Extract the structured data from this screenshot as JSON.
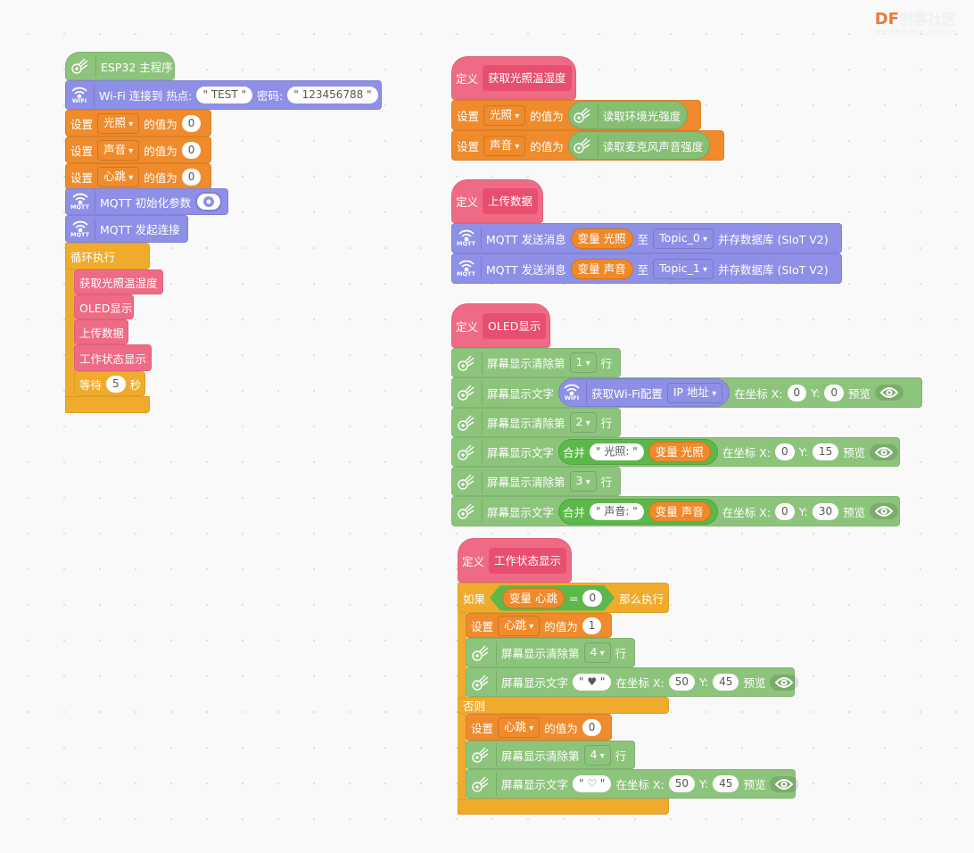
{
  "watermark": {
    "brand_df": "DF",
    "brand_cn": "创客社区",
    "url": "mc.DFRobot.com.cn"
  },
  "colors": {
    "esp": "#8dc47c",
    "wifi": "#8e8fe6",
    "set": "#ef8b2c",
    "control": "#f0ab2d",
    "proc": "#ef6b85",
    "reporter_green": "#86be74"
  },
  "scripts": [
    {
      "rows": [
        {
          "kind": "hat",
          "cat": "esp",
          "parts": [
            {
              "k": "icon",
              "icon": "esp32-hand-icon"
            },
            {
              "k": "t",
              "v": "ESP32 主程序"
            }
          ]
        },
        {
          "kind": "block",
          "cat": "wifi",
          "parts": [
            {
              "k": "icon",
              "icon": "wifi-icon",
              "label": "WIFI"
            },
            {
              "k": "t",
              "v": "Wi-Fi 连接到 热点:"
            },
            {
              "k": "s",
              "v": "\" TEST \""
            },
            {
              "k": "t",
              "v": "密码:"
            },
            {
              "k": "s",
              "v": "\" 123456788 \""
            }
          ]
        },
        {
          "kind": "block",
          "cat": "set",
          "parts": [
            {
              "k": "t",
              "v": "设置"
            },
            {
              "k": "d",
              "v": "光照"
            },
            {
              "k": "t",
              "v": "的值为"
            },
            {
              "k": "n",
              "v": "0"
            }
          ]
        },
        {
          "kind": "block",
          "cat": "set",
          "parts": [
            {
              "k": "t",
              "v": "设置"
            },
            {
              "k": "d",
              "v": "声音"
            },
            {
              "k": "t",
              "v": "的值为"
            },
            {
              "k": "n",
              "v": "0"
            }
          ]
        },
        {
          "kind": "block",
          "cat": "set",
          "parts": [
            {
              "k": "t",
              "v": "设置"
            },
            {
              "k": "d",
              "v": "心跳"
            },
            {
              "k": "t",
              "v": "的值为"
            },
            {
              "k": "n",
              "v": "0"
            }
          ]
        },
        {
          "kind": "block",
          "cat": "wifi",
          "parts": [
            {
              "k": "icon",
              "icon": "mqtt-icon",
              "label": "MQTT"
            },
            {
              "k": "t",
              "v": "MQTT 初始化参数"
            },
            {
              "k": "gear"
            }
          ]
        },
        {
          "kind": "block",
          "cat": "wifi",
          "parts": [
            {
              "k": "icon",
              "icon": "mqtt-icon",
              "label": "MQTT"
            },
            {
              "k": "t",
              "v": "MQTT 发起连接"
            }
          ]
        },
        {
          "kind": "arm",
          "cat": "control",
          "parts": []
        },
        {
          "kind": "block",
          "cat": "control",
          "parts": [
            {
              "k": "t",
              "v": "循环执行"
            }
          ]
        },
        {
          "kind": "block",
          "cat": "proc",
          "parts": [
            {
              "k": "t",
              "v": "获取光照温湿度"
            }
          ]
        },
        {
          "kind": "block",
          "cat": "proc",
          "parts": [
            {
              "k": "t",
              "v": "OLED显示"
            }
          ]
        },
        {
          "kind": "block",
          "cat": "proc",
          "parts": [
            {
              "k": "t",
              "v": "上传数据"
            }
          ]
        },
        {
          "kind": "block",
          "cat": "proc",
          "parts": [
            {
              "k": "t",
              "v": "工作状态显示"
            }
          ]
        },
        {
          "kind": "block",
          "cat": "control",
          "parts": [
            {
              "k": "t",
              "v": "等待"
            },
            {
              "k": "n",
              "v": "5"
            },
            {
              "k": "t",
              "v": "秒"
            }
          ]
        },
        {
          "kind": "cap",
          "cat": "control",
          "parts": []
        }
      ]
    },
    {
      "rows": [
        {
          "kind": "defhat",
          "cat": "proc",
          "parts": [
            {
              "k": "t",
              "v": "定义"
            },
            {
              "k": "def",
              "v": "获取光照温湿度"
            }
          ]
        },
        {
          "kind": "block",
          "cat": "set",
          "parts": [
            {
              "k": "t",
              "v": "设置"
            },
            {
              "k": "d",
              "v": "光照"
            },
            {
              "k": "t",
              "v": "的值为"
            },
            {
              "k": "rep",
              "cat": "reporter_green",
              "parts": [
                {
                  "k": "icon",
                  "icon": "esp32-hand-icon"
                },
                {
                  "k": "t",
                  "v": "读取环境光强度"
                }
              ]
            }
          ]
        },
        {
          "kind": "block",
          "cat": "set",
          "parts": [
            {
              "k": "t",
              "v": "设置"
            },
            {
              "k": "d",
              "v": "声音"
            },
            {
              "k": "t",
              "v": "的值为"
            },
            {
              "k": "rep",
              "cat": "reporter_green",
              "parts": [
                {
                  "k": "icon",
                  "icon": "esp32-hand-icon"
                },
                {
                  "k": "t",
                  "v": "读取麦克风声音强度"
                }
              ]
            }
          ]
        }
      ]
    },
    {
      "rows": [
        {
          "kind": "defhat",
          "cat": "proc",
          "parts": [
            {
              "k": "t",
              "v": "定义"
            },
            {
              "k": "def",
              "v": "上传数据"
            }
          ]
        },
        {
          "kind": "block",
          "cat": "wifi",
          "parts": [
            {
              "k": "icon",
              "icon": "mqtt-icon",
              "label": "MQTT"
            },
            {
              "k": "t",
              "v": "MQTT 发送消息"
            },
            {
              "k": "v",
              "v": "变量 光照"
            },
            {
              "k": "t",
              "v": "至"
            },
            {
              "k": "d",
              "v": "Topic_0"
            },
            {
              "k": "t",
              "v": "并存数据库 (SIoT V2)"
            }
          ]
        },
        {
          "kind": "block",
          "cat": "wifi",
          "parts": [
            {
              "k": "icon",
              "icon": "mqtt-icon",
              "label": "MQTT"
            },
            {
              "k": "t",
              "v": "MQTT 发送消息"
            },
            {
              "k": "v",
              "v": "变量 声音"
            },
            {
              "k": "t",
              "v": "至"
            },
            {
              "k": "d",
              "v": "Topic_1"
            },
            {
              "k": "t",
              "v": "并存数据库 (SIoT V2)"
            }
          ]
        }
      ]
    },
    {
      "rows": [
        {
          "kind": "defhat",
          "cat": "proc",
          "parts": [
            {
              "k": "t",
              "v": "定义"
            },
            {
              "k": "def",
              "v": "OLED显示"
            }
          ]
        },
        {
          "kind": "block",
          "cat": "esp",
          "parts": [
            {
              "k": "icon",
              "icon": "esp32-hand-icon"
            },
            {
              "k": "t",
              "v": "屏幕显示清除第"
            },
            {
              "k": "d",
              "v": "1"
            },
            {
              "k": "t",
              "v": "行"
            }
          ]
        },
        {
          "kind": "block",
          "cat": "esp",
          "parts": [
            {
              "k": "icon",
              "icon": "esp32-hand-icon"
            },
            {
              "k": "t",
              "v": "屏幕显示文字"
            },
            {
              "k": "rep",
              "cat": "wifi",
              "parts": [
                {
                  "k": "icon",
                  "icon": "wifi-icon",
                  "label": "WIFI"
                },
                {
                  "k": "t",
                  "v": "获取Wi-Fi配置"
                },
                {
                  "k": "d",
                  "v": "IP 地址"
                }
              ]
            },
            {
              "k": "t",
              "v": "在坐标 X:"
            },
            {
              "k": "n",
              "v": "0"
            },
            {
              "k": "t",
              "v": "Y:"
            },
            {
              "k": "n",
              "v": "0"
            },
            {
              "k": "t",
              "v": "预览"
            },
            {
              "k": "eye"
            }
          ]
        },
        {
          "kind": "block",
          "cat": "esp",
          "parts": [
            {
              "k": "icon",
              "icon": "esp32-hand-icon"
            },
            {
              "k": "t",
              "v": "屏幕显示清除第"
            },
            {
              "k": "d",
              "v": "2"
            },
            {
              "k": "t",
              "v": "行"
            }
          ]
        },
        {
          "kind": "block",
          "cat": "esp",
          "parts": [
            {
              "k": "icon",
              "icon": "esp32-hand-icon"
            },
            {
              "k": "t",
              "v": "屏幕显示文字"
            },
            {
              "k": "rep",
              "cat": "join",
              "parts": [
                {
                  "k": "t",
                  "v": "合并"
                },
                {
                  "k": "s",
                  "v": "\" 光照: \""
                },
                {
                  "k": "v",
                  "v": "变量 光照"
                }
              ]
            },
            {
              "k": "t",
              "v": "在坐标 X:"
            },
            {
              "k": "n",
              "v": "0"
            },
            {
              "k": "t",
              "v": "Y:"
            },
            {
              "k": "n",
              "v": "15"
            },
            {
              "k": "t",
              "v": "预览"
            },
            {
              "k": "eye"
            }
          ]
        },
        {
          "kind": "block",
          "cat": "esp",
          "parts": [
            {
              "k": "icon",
              "icon": "esp32-hand-icon"
            },
            {
              "k": "t",
              "v": "屏幕显示清除第"
            },
            {
              "k": "d",
              "v": "3"
            },
            {
              "k": "t",
              "v": "行"
            }
          ]
        },
        {
          "kind": "block",
          "cat": "esp",
          "parts": [
            {
              "k": "icon",
              "icon": "esp32-hand-icon"
            },
            {
              "k": "t",
              "v": "屏幕显示文字"
            },
            {
              "k": "rep",
              "cat": "join",
              "parts": [
                {
                  "k": "t",
                  "v": "合并"
                },
                {
                  "k": "s",
                  "v": "\" 声音: \""
                },
                {
                  "k": "v",
                  "v": "变量 声音"
                }
              ]
            },
            {
              "k": "t",
              "v": "在坐标 X:"
            },
            {
              "k": "n",
              "v": "0"
            },
            {
              "k": "t",
              "v": "Y:"
            },
            {
              "k": "n",
              "v": "30"
            },
            {
              "k": "t",
              "v": "预览"
            },
            {
              "k": "eye"
            }
          ]
        }
      ]
    },
    {
      "rows": [
        {
          "kind": "defhat",
          "cat": "proc",
          "parts": [
            {
              "k": "t",
              "v": "定义"
            },
            {
              "k": "def",
              "v": "工作状态显示"
            }
          ]
        },
        {
          "kind": "arm",
          "cat": "control",
          "parts": []
        },
        {
          "kind": "block",
          "cat": "control",
          "parts": [
            {
              "k": "t",
              "v": "如果"
            },
            {
              "k": "bool",
              "parts": [
                {
                  "k": "v",
                  "v": "变量 心跳"
                },
                {
                  "k": "t",
                  "v": "="
                },
                {
                  "k": "n",
                  "v": "0"
                }
              ]
            },
            {
              "k": "t",
              "v": "那么执行"
            }
          ]
        },
        {
          "kind": "block",
          "cat": "set",
          "parts": [
            {
              "k": "t",
              "v": "设置"
            },
            {
              "k": "d",
              "v": "心跳"
            },
            {
              "k": "t",
              "v": "的值为"
            },
            {
              "k": "n",
              "v": "1"
            }
          ]
        },
        {
          "kind": "block",
          "cat": "esp",
          "parts": [
            {
              "k": "icon",
              "icon": "esp32-hand-icon"
            },
            {
              "k": "t",
              "v": "屏幕显示清除第"
            },
            {
              "k": "d",
              "v": "4"
            },
            {
              "k": "t",
              "v": "行"
            }
          ]
        },
        {
          "kind": "block",
          "cat": "esp",
          "parts": [
            {
              "k": "icon",
              "icon": "esp32-hand-icon"
            },
            {
              "k": "t",
              "v": "屏幕显示文字"
            },
            {
              "k": "s",
              "v": "\" ♥ \""
            },
            {
              "k": "t",
              "v": "在坐标 X:"
            },
            {
              "k": "n",
              "v": "50"
            },
            {
              "k": "t",
              "v": "Y:"
            },
            {
              "k": "n",
              "v": "45"
            },
            {
              "k": "t",
              "v": "预览"
            },
            {
              "k": "eye"
            }
          ]
        },
        {
          "kind": "block",
          "cat": "control",
          "parts": [
            {
              "k": "t",
              "v": "否则"
            }
          ]
        },
        {
          "kind": "block",
          "cat": "set",
          "parts": [
            {
              "k": "t",
              "v": "设置"
            },
            {
              "k": "d",
              "v": "心跳"
            },
            {
              "k": "t",
              "v": "的值为"
            },
            {
              "k": "n",
              "v": "0"
            }
          ]
        },
        {
          "kind": "block",
          "cat": "esp",
          "parts": [
            {
              "k": "icon",
              "icon": "esp32-hand-icon"
            },
            {
              "k": "t",
              "v": "屏幕显示清除第"
            },
            {
              "k": "d",
              "v": "4"
            },
            {
              "k": "t",
              "v": "行"
            }
          ]
        },
        {
          "kind": "block",
          "cat": "esp",
          "parts": [
            {
              "k": "icon",
              "icon": "esp32-hand-icon"
            },
            {
              "k": "t",
              "v": "屏幕显示文字"
            },
            {
              "k": "s",
              "v": "\" ♡ \""
            },
            {
              "k": "t",
              "v": "在坐标 X:"
            },
            {
              "k": "n",
              "v": "50"
            },
            {
              "k": "t",
              "v": "Y:"
            },
            {
              "k": "n",
              "v": "45"
            },
            {
              "k": "t",
              "v": "预览"
            },
            {
              "k": "eye"
            }
          ]
        },
        {
          "kind": "cap",
          "cat": "control",
          "parts": []
        }
      ]
    }
  ]
}
